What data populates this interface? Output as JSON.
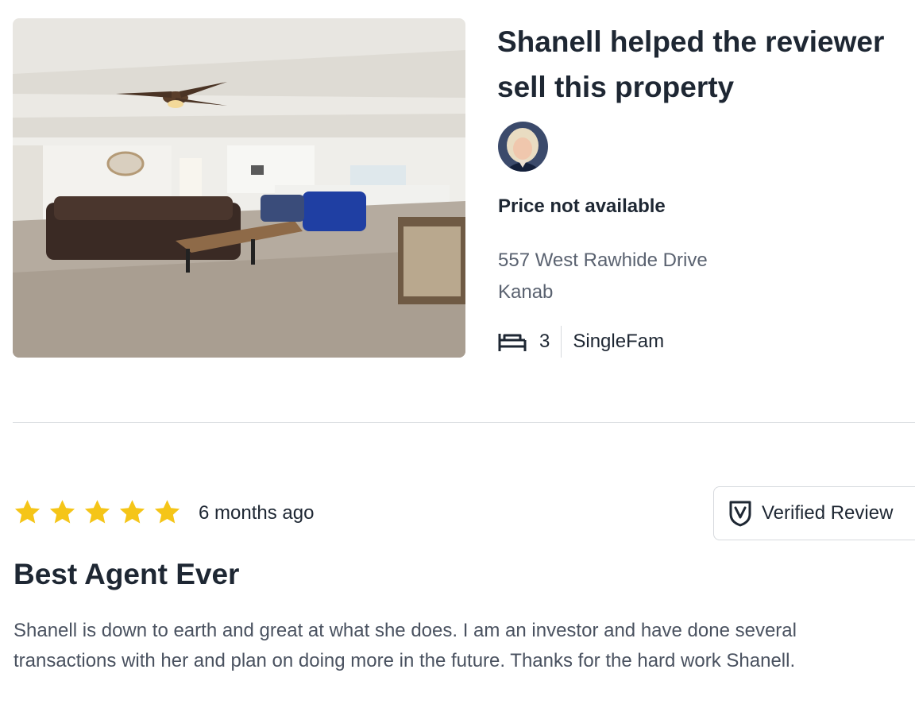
{
  "property": {
    "title_line1": "Shanell helped the reviewer",
    "title_line2": "sell this property",
    "price": "Price not available",
    "address_line1": "557 West Rawhide Drive",
    "address_line2": "Kanab",
    "beds": "3",
    "type": "SingleFam",
    "bed_icon": "bed-icon",
    "avatar": "agent-avatar"
  },
  "review": {
    "rating": 5,
    "rating_max": 5,
    "time": "6 months ago",
    "verified_label": "Verified Review",
    "verified_icon": "shield-check-icon",
    "title": "Best Agent Ever",
    "body_line1": "Shanell is down to earth and great at what she does. I am an investor and have done several",
    "body_line2": "transactions with her and plan on doing more in the future. Thanks for the hard work Shanell."
  },
  "colors": {
    "star": "#f5c518",
    "text": "#1e2733",
    "muted": "#5a6270",
    "border": "#d6d9dd"
  }
}
